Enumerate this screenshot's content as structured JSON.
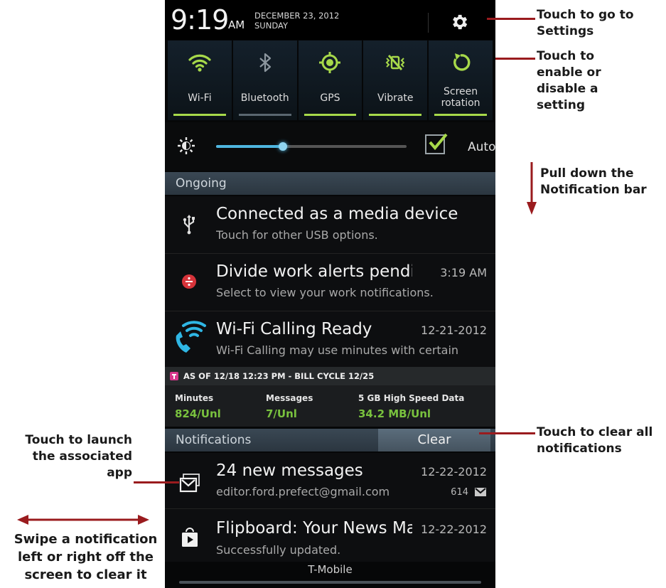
{
  "statusbar": {
    "time": "9:19",
    "ampm": "AM",
    "date": "DECEMBER 23, 2012",
    "weekday": "SUNDAY",
    "settings_icon": "gear-icon"
  },
  "toggles": [
    {
      "label": "Wi-Fi",
      "icon": "wifi-icon",
      "on": true
    },
    {
      "label": "Bluetooth",
      "icon": "bluetooth-icon",
      "on": false
    },
    {
      "label": "GPS",
      "icon": "gps-icon",
      "on": true
    },
    {
      "label": "Vibrate",
      "icon": "vibrate-icon",
      "on": true
    },
    {
      "label": "Screen rotation",
      "icon": "rotation-icon",
      "on": true
    }
  ],
  "brightness": {
    "level": 0.35,
    "auto_label": "Auto",
    "auto_checked": true
  },
  "ongoing": {
    "header": "Ongoing",
    "items": [
      {
        "title": "Connected as a media device",
        "subtitle": "Touch for other USB options.",
        "time": "",
        "icon": "usb-icon"
      },
      {
        "title": "Divide work alerts pending",
        "subtitle": "Select to view your work notifications.",
        "time": "3:19 AM",
        "icon": "divide-icon"
      },
      {
        "title": "Wi-Fi Calling Ready",
        "subtitle": "Wi-Fi Calling may use minutes with certain",
        "time": "12-21-2012",
        "icon": "wifi-calling-icon"
      }
    ]
  },
  "carrier_widget": {
    "header": "AS OF 12/18 12:23 PM - BILL CYCLE 12/25",
    "stats": [
      {
        "label": "Minutes",
        "value": "824/Unl"
      },
      {
        "label": "Messages",
        "value": "7/Unl"
      },
      {
        "label": "5 GB High Speed Data",
        "value": "34.2 MB/Unl"
      }
    ]
  },
  "notifications": {
    "header": "Notifications",
    "clear_label": "Clear",
    "items": [
      {
        "title": "24 new messages",
        "subtitle": "editor.ford.prefect@gmail.com",
        "time": "12-22-2012",
        "count": "614",
        "icon": "gmail-icon"
      },
      {
        "title": "Flipboard: Your News Magazine",
        "subtitle": "Successfully updated.",
        "time": "12-22-2012",
        "icon": "play-store-icon"
      }
    ]
  },
  "carrier_name": "T-Mobile",
  "callouts": {
    "settings": "Touch to go to Settings",
    "toggle": "Touch to enable or disable a setting",
    "pull": "Pull down the Notification bar",
    "clear": "Touch to clear all notifications",
    "launch": "Touch to launch the associated app",
    "swipe": "Swipe a notification left or right off the screen to clear it"
  },
  "colors": {
    "accent_green": "#a7d94a",
    "accent_blue": "#4fb6e0",
    "callout_red": "#9a1b1e"
  }
}
